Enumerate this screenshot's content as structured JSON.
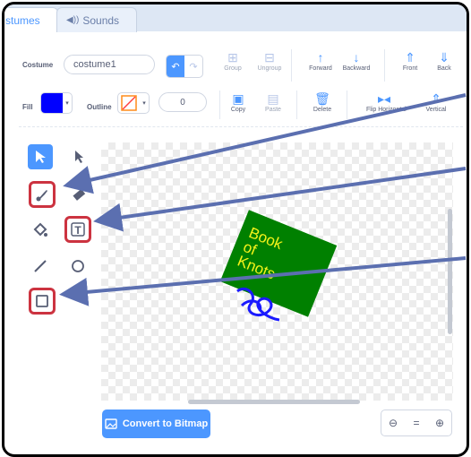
{
  "tabs": {
    "costumes": "stumes",
    "sounds": "Sounds"
  },
  "costume": {
    "label": "Costume",
    "name": "costume1"
  },
  "toolbar": {
    "group": "Group",
    "ungroup": "Ungroup",
    "forward": "Forward",
    "backward": "Backward",
    "front": "Front",
    "back": "Back",
    "copy": "Copy",
    "paste": "Paste",
    "delete": "Delete",
    "flip_h": "Flip Horizontal",
    "flip_v": "Vertical"
  },
  "fill": {
    "label": "Fill",
    "color": "#0000ff"
  },
  "outline": {
    "label": "Outline",
    "width": "0"
  },
  "canvas": {
    "book_text": [
      "Book",
      "of",
      "Knots"
    ],
    "book_color": "#008000",
    "text_color": "#f4f21a"
  },
  "convert_button": "Convert to Bitmap",
  "zoom": {
    "out": "⊖",
    "reset": "=",
    "in": "⊕"
  },
  "colors": {
    "accent": "#4c97ff",
    "highlight": "#cc3340",
    "annotation_arrow": "#5b6fb0"
  }
}
